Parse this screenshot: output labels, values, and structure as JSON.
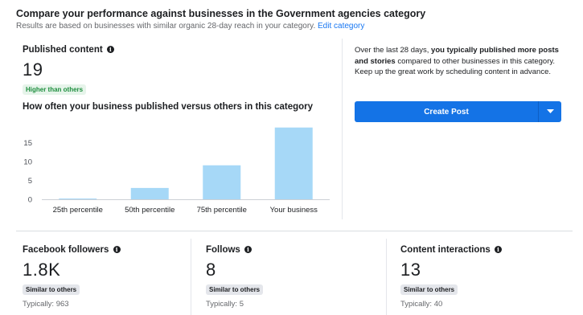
{
  "header": {
    "title": "Compare your performance against businesses in the Government agencies category",
    "subtitle": "Results are based on businesses with similar organic 28-day reach in your category.",
    "edit_link": "Edit category"
  },
  "published": {
    "label": "Published content",
    "value": "19",
    "badge": "Higher than others"
  },
  "chart_title": "How often your business published versus others in this category",
  "chart_data": {
    "type": "bar",
    "categories": [
      "25th percentile",
      "50th percentile",
      "75th percentile",
      "Your business"
    ],
    "values": [
      0.2,
      3,
      9,
      19
    ],
    "yticks": [
      0,
      5,
      10,
      15
    ],
    "ylim": [
      0,
      20
    ],
    "bar_color": "#a6d8f7",
    "grid": false
  },
  "insight": {
    "prefix": "Over the last 28 days, ",
    "bold": "you typically published more posts and stories",
    "suffix": " compared to other businesses in this category. Keep up the great work by scheduling content in advance."
  },
  "create_button": {
    "label": "Create Post",
    "dropdown_icon": "caret-down-icon",
    "color": "#1473e6"
  },
  "stats": [
    {
      "label": "Facebook followers",
      "value": "1.8K",
      "badge": "Similar to others",
      "typical": "Typically: 963"
    },
    {
      "label": "Follows",
      "value": "8",
      "badge": "Similar to others",
      "typical": "Typically: 5"
    },
    {
      "label": "Content interactions",
      "value": "13",
      "badge": "Similar to others",
      "typical": "Typically: 40"
    }
  ]
}
